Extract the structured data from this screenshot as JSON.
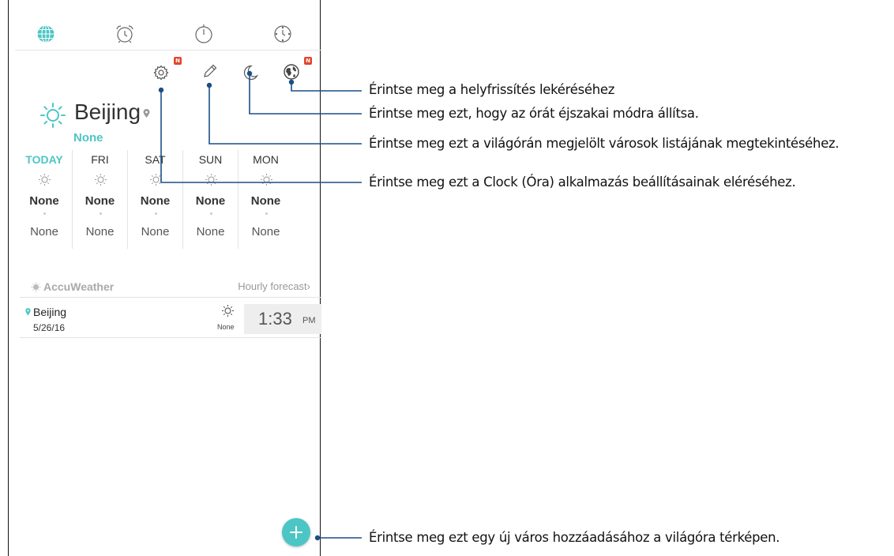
{
  "tabs": [
    {
      "icon": "globe-icon"
    },
    {
      "icon": "alarm-clock-icon"
    },
    {
      "icon": "stopwatch-icon"
    },
    {
      "icon": "timer-icon"
    }
  ],
  "toolbar": {
    "settings_icon": "gear-icon",
    "settings_badge": "N",
    "edit_icon": "pencil-icon",
    "night_icon": "moon-icon",
    "location_icon": "globe-locate-icon",
    "location_badge": "N"
  },
  "current": {
    "city": "Beijing",
    "condition": "None",
    "icon": "sun-icon"
  },
  "forecast": [
    {
      "day": "TODAY",
      "high": "None",
      "low": "None"
    },
    {
      "day": "FRI",
      "high": "None",
      "low": "None"
    },
    {
      "day": "SAT",
      "high": "None",
      "low": "None"
    },
    {
      "day": "SUN",
      "high": "None",
      "low": "None"
    },
    {
      "day": "MON",
      "high": "None",
      "low": "None"
    }
  ],
  "provider": "AccuWeather",
  "hourly_link": "Hourly forecast",
  "world_clock": {
    "city": "Beijing",
    "date": "5/26/16",
    "condition": "None",
    "time": "1:33",
    "ampm": "PM"
  },
  "callouts": {
    "location": "Érintse meg a helyfrissítés lekéréséhez",
    "night": "Érintse meg ezt, hogy az órát éjszakai módra állítsa.",
    "cities": "Érintse meg ezt a világórán megjelölt városok listájának megtekintéséhez.",
    "settings": "Érintse meg ezt a Clock (Óra) alkalmazás beállításainak eléréséhez.",
    "add_city": "Érintse meg ezt egy új város hozzáadásához a világóra térképen."
  },
  "colors": {
    "accent": "#4cc6c5",
    "badge": "#e2462a",
    "callout_line": "#1a4f86"
  }
}
